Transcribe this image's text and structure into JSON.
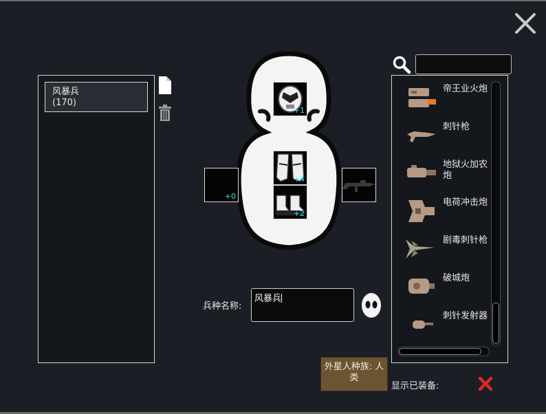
{
  "colors": {
    "background": "#1b1e24",
    "quantity_text": "#2fe0ec",
    "toggle_off": "#d42a2a",
    "race_button": "#6b5432"
  },
  "window": {
    "close_icon": "close-icon"
  },
  "unit_list": {
    "items": [
      {
        "name": "风暴兵",
        "count": "(170)"
      }
    ],
    "new_icon": "new-document-icon",
    "delete_icon": "trash-icon"
  },
  "body_slots": {
    "head": {
      "quantity": "+1",
      "icon": "helmet-icon"
    },
    "legs": {
      "quantity": "+4",
      "icon": "leg-armor-icon"
    },
    "feet": {
      "quantity": "+2",
      "icon": "boots-icon"
    },
    "left_hand": {
      "quantity": "+0"
    },
    "right_hand": {
      "icon": "rifle-icon"
    }
  },
  "unit_name": {
    "label": "兵种名称:",
    "value": "风暴兵",
    "portrait_icon": "alien-face-icon"
  },
  "search": {
    "icon": "search-icon",
    "value": ""
  },
  "weapons": [
    {
      "label": "帝王业火炮"
    },
    {
      "label": "刺针枪"
    },
    {
      "label": "地狱火加农炮"
    },
    {
      "label": "电荷冲击炮"
    },
    {
      "label": "剧毒刺针枪"
    },
    {
      "label": "破城炮"
    },
    {
      "label": "刺针发射器"
    }
  ],
  "race_button": {
    "label": "外星人种族: 人类"
  },
  "show_equipped": {
    "label": "显示已装备:",
    "state_icon": "red-x-icon"
  }
}
